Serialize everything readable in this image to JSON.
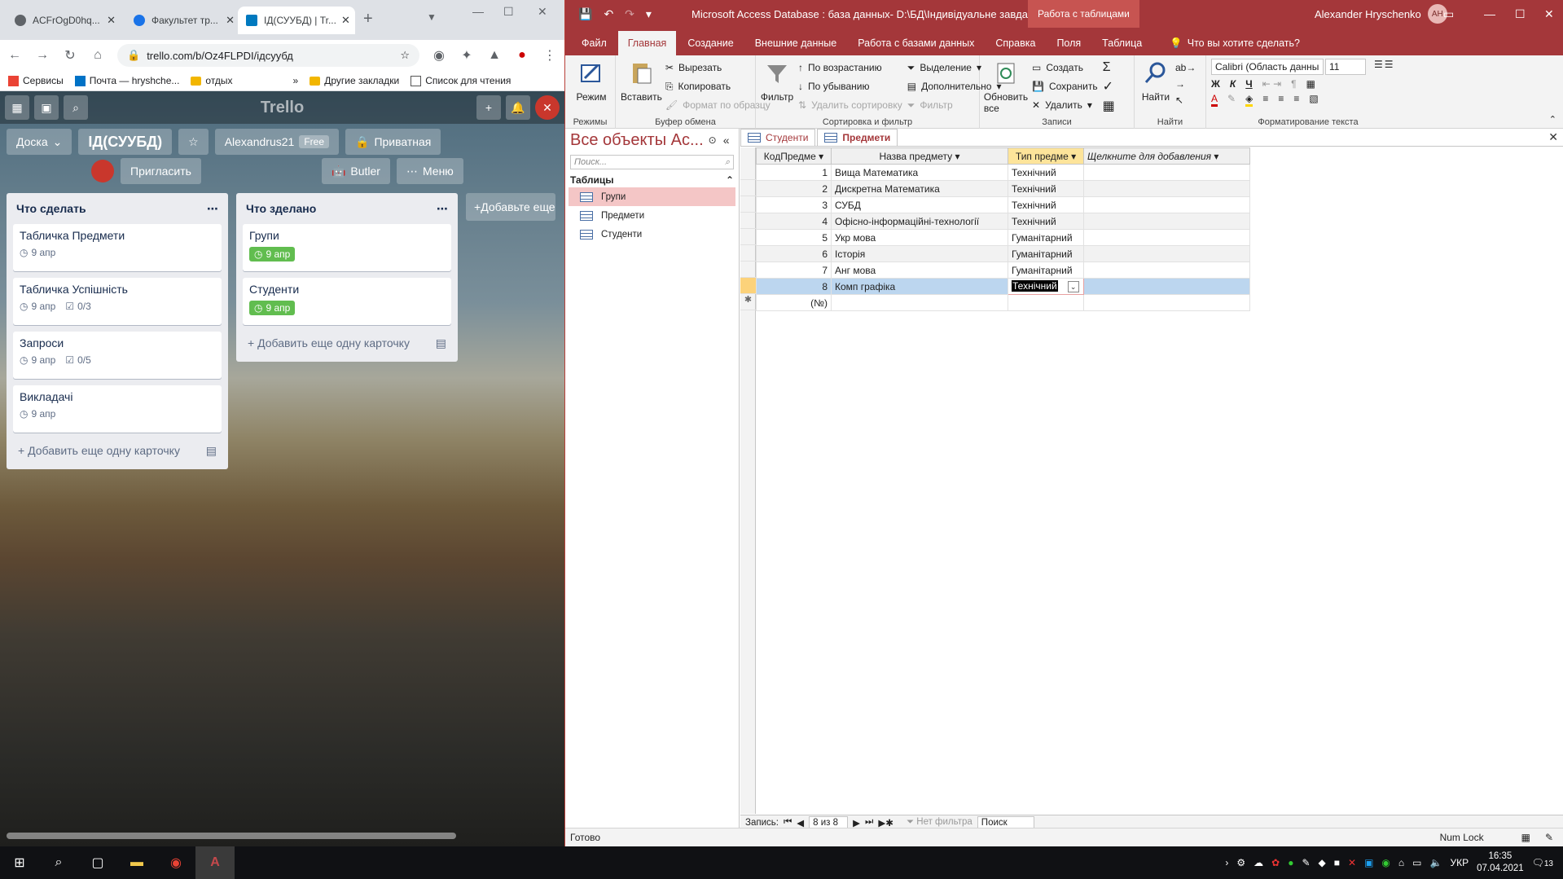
{
  "browser": {
    "tabs": [
      {
        "title": "ACFrOgD0hq..."
      },
      {
        "title": "Факультет тр..."
      },
      {
        "title": "ІД(СУУБД) | Tr..."
      }
    ],
    "url": "trello.com/b/Oz4FLPDI/ідсуубд",
    "bookmarks": [
      "Сервисы",
      "Почта — hryshche...",
      "отдых",
      "»",
      "Другие закладки",
      "Список для чтения"
    ]
  },
  "trello": {
    "logo": "Trello",
    "board_menu": "Доска",
    "board_title": "ІД(СУУБД)",
    "workspace": "Alexandrus21",
    "workspace_badge": "Free",
    "visibility": "Приватная",
    "invite": "Пригласить",
    "butler": "Butler",
    "menu": "Меню",
    "add_list": "Добавьте еще",
    "lists": [
      {
        "title": "Что сделать",
        "cards": [
          {
            "title": "Табличка Предмети",
            "due": "9 апр",
            "checklist": ""
          },
          {
            "title": "Табличка Успішність",
            "due": "9 апр",
            "checklist": "0/3"
          },
          {
            "title": "Запроси",
            "due": "9 апр",
            "checklist": "0/5"
          },
          {
            "title": "Викладачі",
            "due": "9 апр",
            "checklist": ""
          }
        ],
        "add": "Добавить еще одну карточку"
      },
      {
        "title": "Что зделано",
        "cards": [
          {
            "title": "Групи",
            "due": "9 апр",
            "done": true
          },
          {
            "title": "Студенти",
            "due": "9 апр",
            "done": true
          }
        ],
        "add": "Добавить еще одну карточку"
      }
    ]
  },
  "access": {
    "title": "Microsoft Access Database : база данных- D:\\БД\\Індивідуальне завдання...",
    "context_tab": "Работа с таблицами",
    "user": "Alexander Hryschenko",
    "user_initials": "AH",
    "ribbon_tabs": [
      "Файл",
      "Главная",
      "Создание",
      "Внешние данные",
      "Работа с базами данных",
      "Справка",
      "Поля",
      "Таблица"
    ],
    "tell_me": "Что вы хотите сделать?",
    "ribbon": {
      "views": {
        "mode": "Режим",
        "label": "Режимы"
      },
      "clipboard": {
        "paste": "Вставить",
        "cut": "Вырезать",
        "copy": "Копировать",
        "format_painter": "Формат по образцу",
        "label": "Буфер обмена"
      },
      "sort": {
        "filter": "Фильтр",
        "asc": "По возрастанию",
        "desc": "По убыванию",
        "remove_sort": "Удалить сортировку",
        "selection": "Выделение",
        "advanced": "Дополнительно",
        "toggle_filter": "Фильтр",
        "label": "Сортировка и фильтр"
      },
      "records": {
        "refresh": "Обновить все",
        "new": "Создать",
        "save": "Сохранить",
        "delete": "Удалить",
        "label": "Записи"
      },
      "find": {
        "find": "Найти",
        "label": "Найти"
      },
      "text": {
        "font": "Calibri (Область данны",
        "size": "11",
        "bold": "Ж",
        "italic": "К",
        "underline": "Ч",
        "label": "Форматирование текста"
      }
    },
    "nav_pane": {
      "title": "Все объекты Ac...",
      "search_placeholder": "Поиск...",
      "group": "Таблицы",
      "items": [
        "Групи",
        "Предмети",
        "Студенти"
      ]
    },
    "doc_tabs": [
      "Студенти",
      "Предмети"
    ],
    "table": {
      "columns": [
        "КодПредме",
        "Назва предмету",
        "Тип предме",
        "Щелкните для добавления"
      ],
      "rows": [
        {
          "id": "1",
          "name": "Вища Математика",
          "type": "Технічний"
        },
        {
          "id": "2",
          "name": "Дискретна Математика",
          "type": "Технічний"
        },
        {
          "id": "3",
          "name": "СУБД",
          "type": "Технічний"
        },
        {
          "id": "4",
          "name": "Офісно-інформаційні-технології",
          "type": "Технічний"
        },
        {
          "id": "5",
          "name": "Укр мова",
          "type": "Гуманітарний"
        },
        {
          "id": "6",
          "name": "Історія",
          "type": "Гуманітарний"
        },
        {
          "id": "7",
          "name": "Анг мова",
          "type": "Гуманітарний"
        },
        {
          "id": "8",
          "name": "Комп графіка",
          "type": "Технічний"
        }
      ],
      "new_row_id": "(№)"
    },
    "record_nav": {
      "label": "Запись:",
      "position": "8 из 8",
      "filter": "Нет фильтра",
      "search": "Поиск"
    },
    "status": {
      "left": "Готово",
      "right": "Num Lock"
    }
  },
  "taskbar": {
    "lang": "УКР",
    "time": "16:35",
    "date": "07.04.2021",
    "notifications": "13"
  }
}
